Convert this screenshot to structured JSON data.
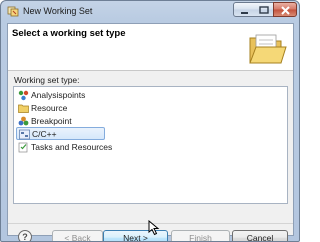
{
  "window": {
    "title": "New Working Set",
    "icon": "eclipse-workbench-icon",
    "controls": [
      "minimize-icon",
      "maximize-icon",
      "close-icon"
    ]
  },
  "header": {
    "title": "Select a working set type",
    "image": "open-folder-icon"
  },
  "working_set": {
    "label": "Working set type:",
    "items": [
      {
        "label": "Analysispoints",
        "icon": "analysispoints-icon",
        "selected": false
      },
      {
        "label": "Resource",
        "icon": "folder-icon",
        "selected": false
      },
      {
        "label": "Breakpoint",
        "icon": "breakpoint-icon",
        "selected": false
      },
      {
        "label": "C/C++",
        "icon": "cpp-icon",
        "selected": true
      },
      {
        "label": "Tasks and Resources",
        "icon": "tasks-icon",
        "selected": false
      }
    ]
  },
  "buttons": {
    "help": "?",
    "back": "< Back",
    "next": "Next >",
    "finish": "Finish",
    "cancel": "Cancel"
  },
  "colors": {
    "selection_border": "#84acdd",
    "default_button_border": "#3c7fb1"
  }
}
